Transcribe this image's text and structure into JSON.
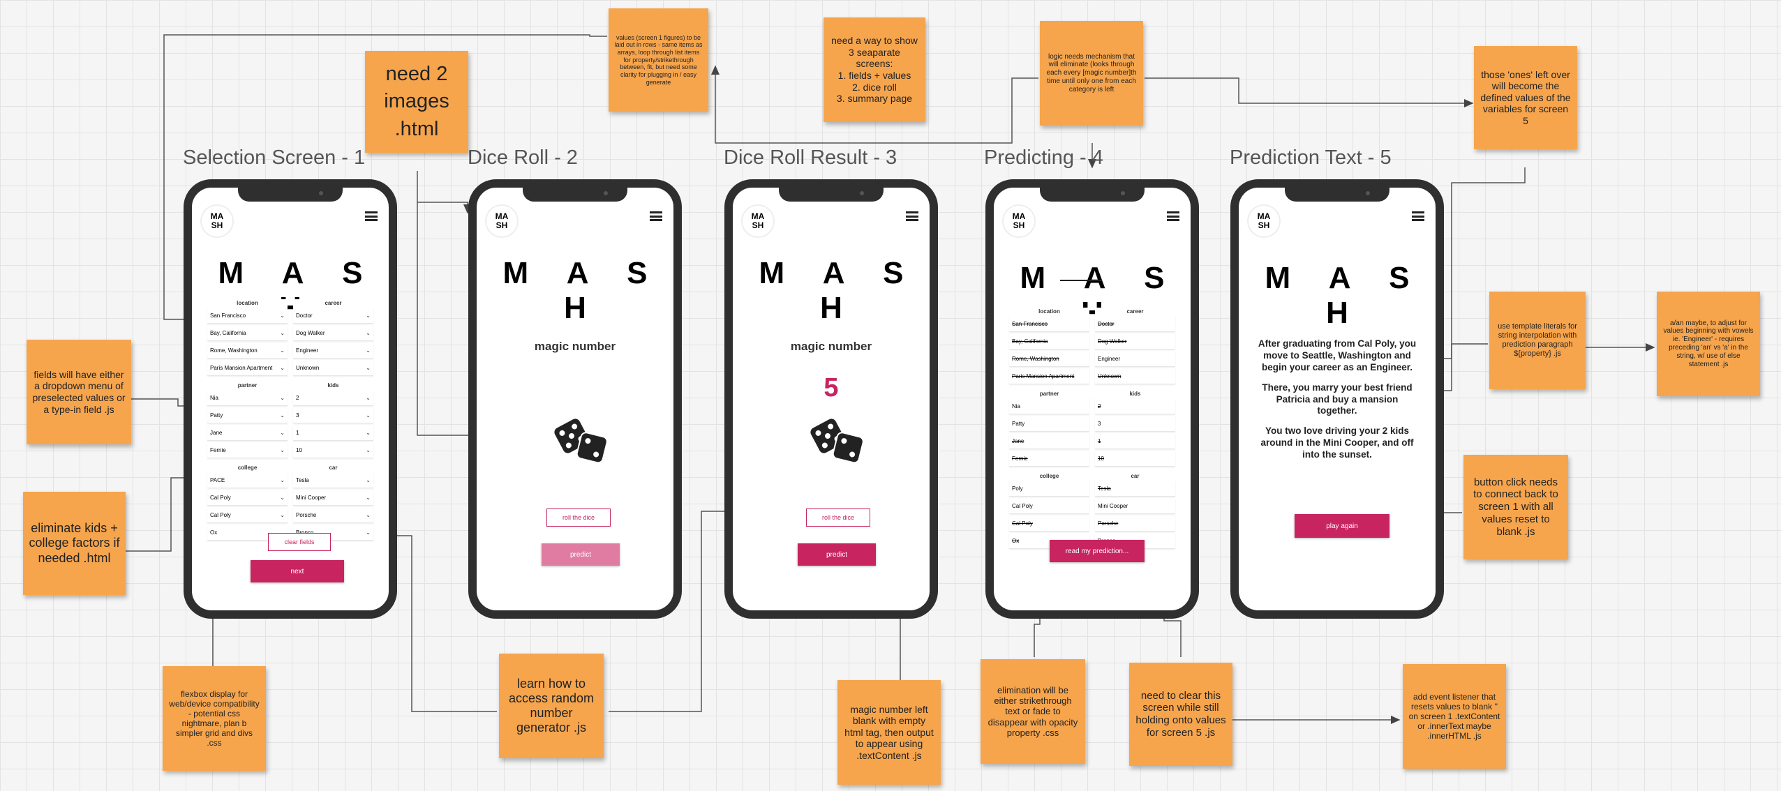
{
  "screens": [
    {
      "title": "Selection Screen - 1"
    },
    {
      "title": "Dice Roll - 2"
    },
    {
      "title": "Dice Roll Result - 3"
    },
    {
      "title": "Predicting - 4"
    },
    {
      "title": "Prediction Text - 5"
    }
  ],
  "app": {
    "logo": "MA\nSH",
    "title": "M A S H"
  },
  "categories": [
    {
      "name": "location",
      "options": [
        "San Francisco",
        "Bay, California",
        "Rome, Washington",
        "Paris Mansion Apartment"
      ]
    },
    {
      "name": "career",
      "options": [
        "Doctor",
        "Dog Walker",
        "Engineer",
        "Unknown"
      ]
    },
    {
      "name": "partner",
      "options": [
        "Nia",
        "Patty",
        "Jane",
        "Fernie"
      ]
    },
    {
      "name": "kids",
      "options": [
        "2",
        "3",
        "1",
        "10"
      ]
    },
    {
      "name": "college",
      "options": [
        "PACE",
        "Cal Poly",
        "Cal Poly",
        "Ox"
      ]
    },
    {
      "name": "car",
      "options": [
        "Tesla",
        "Mini Cooper",
        "Porsche",
        "Bronco"
      ]
    }
  ],
  "predicting_categories": [
    {
      "name": "location",
      "options": [
        "San Francisco",
        "Bay, California",
        "Rome, Washington",
        "Paris Mansion Apartment"
      ]
    },
    {
      "name": "career",
      "options": [
        "Doctor",
        "Dog Walker",
        "Engineer",
        "Unknown"
      ]
    },
    {
      "name": "partner",
      "options": [
        "Nia",
        "Patty",
        "Jane",
        "Fernie"
      ]
    },
    {
      "name": "kids",
      "options": [
        "2",
        "3",
        "1",
        "10"
      ]
    },
    {
      "name": "college",
      "options": [
        "Poly",
        "Cal Poly",
        "Cal Poly",
        "Ox"
      ]
    },
    {
      "name": "car",
      "options": [
        "Tesla",
        "Mini Cooper",
        "Porsche",
        "Bronco"
      ]
    }
  ],
  "screen1": {
    "clear_label": "clear fields",
    "next_label": "next"
  },
  "screen2": {
    "magic_label": "magic number",
    "roll_label": "roll the dice",
    "predict_label": "predict"
  },
  "screen3": {
    "magic_label": "magic number",
    "number": "5",
    "roll_label": "roll the dice",
    "predict_label": "predict"
  },
  "screen4": {
    "read_label": "read my prediction..."
  },
  "screen5": {
    "p1": "After graduating from Cal Poly, you move to Seattle, Washington and begin your career as an Engineer.",
    "p2": "There, you marry your best friend Patricia and buy a mansion together.",
    "p3": "You two love driving your 2 kids around in the Mini Cooper, and off into the sunset.",
    "play_again_label": "play again"
  },
  "stickies": {
    "values": "values (screen 1 figures) to be laid out in rows - same items as arrays, loop through list items for property/strikethrough between, fit, but need some clarity for plugging in / easy generate",
    "need_images": "need 2 images .html",
    "three_screens": "need a way to show 3 seaparate screens:\n1. fields + values\n2. dice roll\n3. summary page",
    "logic": "logic needs mechanism that will eliminate (looks through each every [magic number]th time until only one from each category is left",
    "ones_left": "those 'ones' left over will become the defined values of the variables for screen 5",
    "fields": "fields will have either a dropdown menu of preselected values or a type-in field .js",
    "eliminate": "eliminate kids + college factors if needed .html",
    "template": "use template literals for string interpolation with prediction paragraph ${property} .js",
    "a_an": "a/an maybe, to adjust for values beginning with vowels ie. 'Engineer' - requires preceding 'an' vs 'a' in the string, w/ use of else statement .js",
    "button_click": "button click needs to connect back to screen 1 with all values reset to blank .js",
    "flexbox": "flexbox display for web/device compatibility - potential css nightmare, plan b simpler grid and divs .css",
    "random": "learn how to access random number generator .js",
    "magic_blank": "magic number left blank with empty html tag, then output to appear using .textContent .js",
    "elimination": "elimination will be either strikethrough text or fade to disappear with opacity property .css",
    "clear_screen": "need to clear this screen while still holding onto values for screen 5 .js",
    "event_listener": "add event listener that resets values to blank '' on screen 1 .textContent or .innerText maybe .innerHTML .js"
  }
}
